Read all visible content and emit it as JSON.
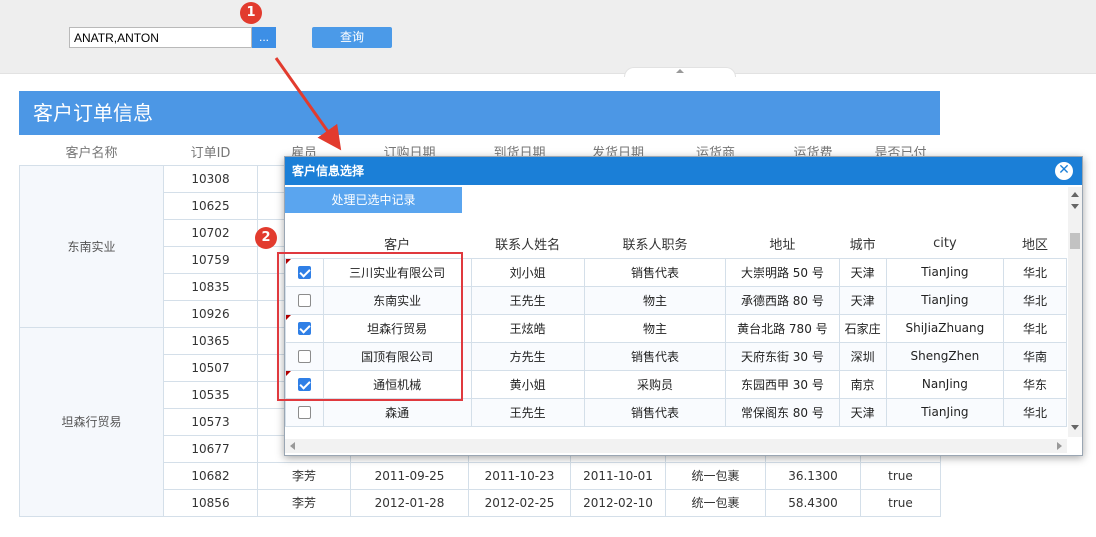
{
  "toolbar": {
    "customer_value": "ANATR,ANTON",
    "dots_label": "...",
    "query_label": "查询"
  },
  "report": {
    "title": "客户订单信息",
    "columns": [
      "客户名称",
      "订单ID",
      "雇员",
      "订购日期",
      "到货日期",
      "发货日期",
      "运货商",
      "运货费",
      "是否已付"
    ],
    "groups": [
      {
        "customer": "东南实业",
        "order_ids": [
          "10308",
          "10625",
          "10702",
          "10759",
          "10835",
          "10926"
        ]
      },
      {
        "customer": "坦森行贸易",
        "order_ids": [
          "10365",
          "10507",
          "10535",
          "10573",
          "10677"
        ]
      }
    ],
    "tail_rows": [
      [
        "10682",
        "李芳",
        "2011-09-25",
        "2011-10-23",
        "2011-10-01",
        "统一包裹",
        "36.1300",
        "true"
      ],
      [
        "10856",
        "李芳",
        "2012-01-28",
        "2012-02-25",
        "2012-02-10",
        "统一包裹",
        "58.4300",
        "true"
      ]
    ]
  },
  "modal": {
    "title": "客户信息选择",
    "close_label": "✕",
    "batch_button": "处理已选中记录",
    "columns": [
      "",
      "客户",
      "联系人姓名",
      "联系人职务",
      "地址",
      "城市",
      "city",
      "地区"
    ],
    "rows": [
      {
        "checked": true,
        "flag": true,
        "cells": [
          "三川实业有限公司",
          "刘小姐",
          "销售代表",
          "大崇明路 50 号",
          "天津",
          "TianJing",
          "华北"
        ]
      },
      {
        "checked": false,
        "flag": false,
        "cells": [
          "东南实业",
          "王先生",
          "物主",
          "承德西路 80 号",
          "天津",
          "TianJing",
          "华北"
        ]
      },
      {
        "checked": true,
        "flag": true,
        "cells": [
          "坦森行贸易",
          "王炫皓",
          "物主",
          "黄台北路 780 号",
          "石家庄",
          "ShiJiaZhuang",
          "华北"
        ]
      },
      {
        "checked": false,
        "flag": false,
        "cells": [
          "国顶有限公司",
          "方先生",
          "销售代表",
          "天府东街 30 号",
          "深圳",
          "ShengZhen",
          "华南"
        ]
      },
      {
        "checked": true,
        "flag": true,
        "cells": [
          "通恒机械",
          "黄小姐",
          "采购员",
          "东园西甲 30 号",
          "南京",
          "NanJing",
          "华东"
        ]
      },
      {
        "checked": false,
        "flag": false,
        "cells": [
          "森通",
          "王先生",
          "销售代表",
          "常保阁东 80 号",
          "天津",
          "TianJing",
          "华北"
        ]
      }
    ]
  },
  "annotations": {
    "badge1": "1",
    "badge2": "2"
  },
  "colors": {
    "accent": "#4c97e5",
    "modal_header": "#1b7fd7",
    "annotation": "#e23b2e"
  }
}
